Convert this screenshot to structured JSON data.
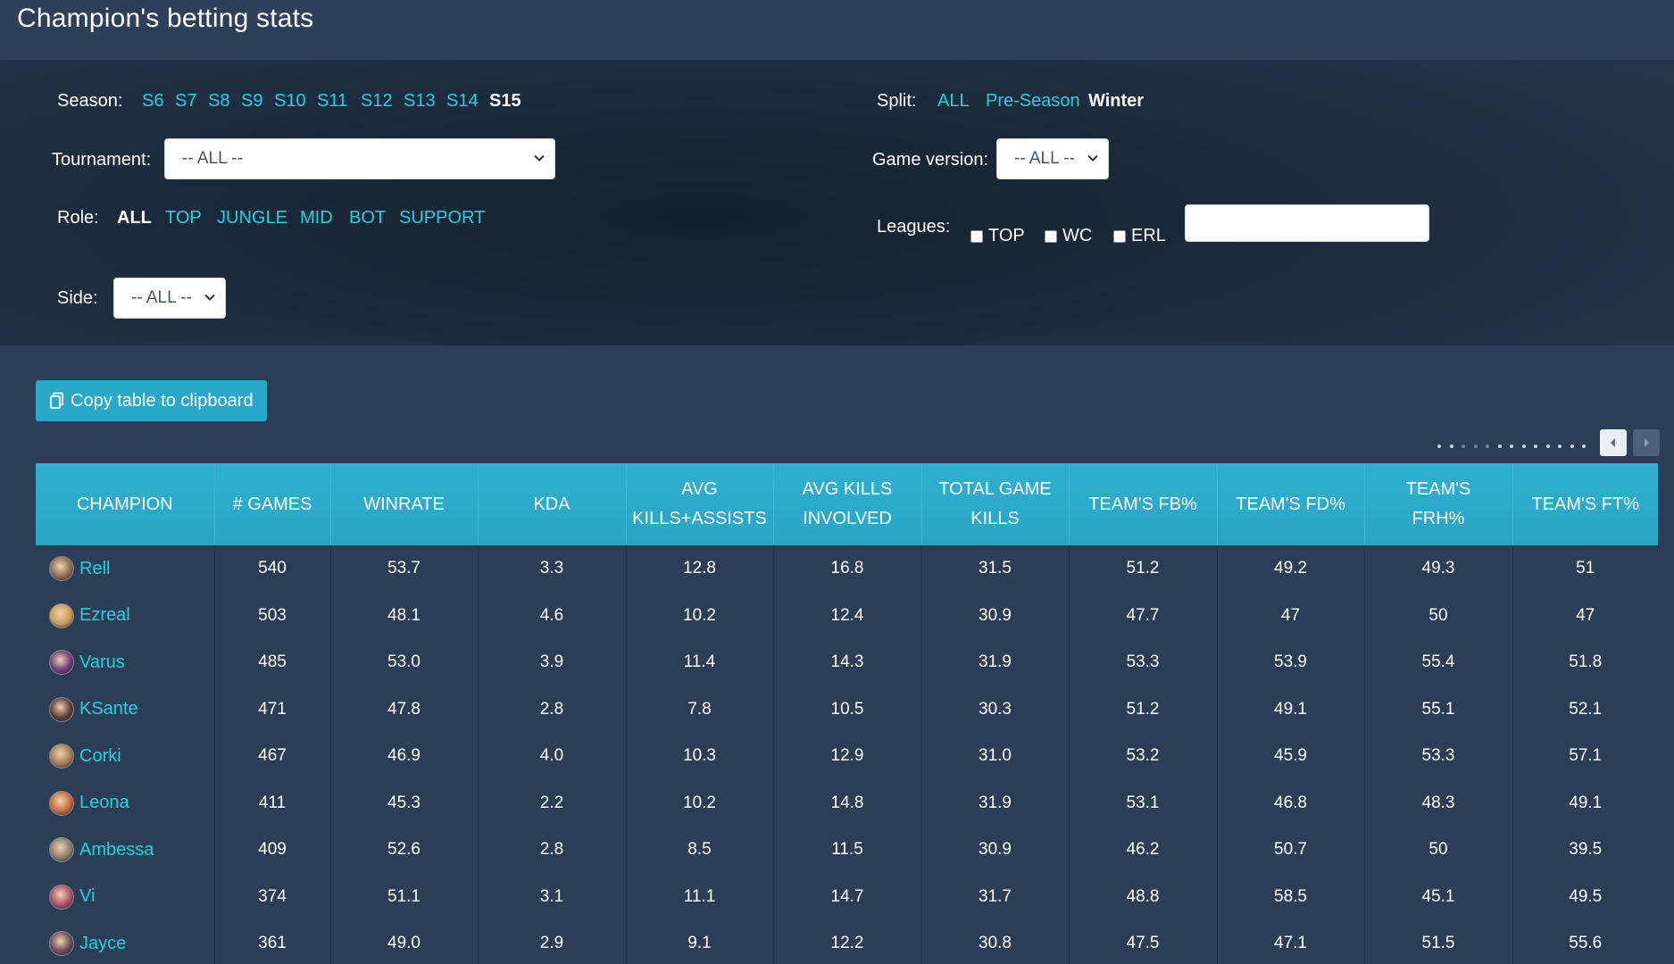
{
  "page": {
    "title": "Champion's betting stats"
  },
  "filters": {
    "season": {
      "label": "Season:",
      "options": [
        "S6",
        "S7",
        "S8",
        "S9",
        "S10",
        "S11",
        "S12",
        "S13",
        "S14",
        "S15"
      ],
      "selected": "S15"
    },
    "split": {
      "label": "Split:",
      "options": [
        "ALL",
        "Pre-Season",
        "Winter"
      ],
      "selected": "Winter"
    },
    "tournament": {
      "label": "Tournament:",
      "value": "-- ALL --"
    },
    "game_version": {
      "label": "Game version:",
      "value": "-- ALL --"
    },
    "role": {
      "label": "Role:",
      "options": [
        "ALL",
        "TOP",
        "JUNGLE",
        "MID",
        "BOT",
        "SUPPORT"
      ],
      "selected": "ALL"
    },
    "leagues": {
      "label": "Leagues:",
      "checkboxes": [
        {
          "label": "TOP",
          "checked": false
        },
        {
          "label": "WC",
          "checked": false
        },
        {
          "label": "ERL",
          "checked": false
        }
      ],
      "search_value": ""
    },
    "side": {
      "label": "Side:",
      "value": "-- ALL --"
    }
  },
  "toolbar": {
    "copy_label": "Copy table to clipboard"
  },
  "table": {
    "headers": [
      [
        "CHAMPION"
      ],
      [
        "# GAMES"
      ],
      [
        "WINRATE"
      ],
      [
        "KDA"
      ],
      [
        "AVG",
        "KILLS+ASSISTS"
      ],
      [
        "AVG KILLS",
        "INVOLVED"
      ],
      [
        "TOTAL GAME",
        "KILLS"
      ],
      [
        "TEAM'S FB%"
      ],
      [
        "TEAM'S FD%"
      ],
      [
        "TEAM'S",
        "FRH%"
      ],
      [
        "TEAM'S FT%"
      ]
    ],
    "rows": [
      {
        "champion": "Rell",
        "avatar_color": "#8a6a55",
        "cells": [
          "540",
          "53.7",
          "3.3",
          "12.8",
          "16.8",
          "31.5",
          "51.2",
          "49.2",
          "49.3",
          "51"
        ]
      },
      {
        "champion": "Ezreal",
        "avatar_color": "#c79a5a",
        "cells": [
          "503",
          "48.1",
          "4.6",
          "10.2",
          "12.4",
          "30.9",
          "47.7",
          "47",
          "50",
          "47"
        ]
      },
      {
        "champion": "Varus",
        "avatar_color": "#6b3a78",
        "cells": [
          "485",
          "53.0",
          "3.9",
          "11.4",
          "14.3",
          "31.9",
          "53.3",
          "53.9",
          "55.4",
          "51.8"
        ]
      },
      {
        "champion": "KSante",
        "avatar_color": "#5a3a35",
        "cells": [
          "471",
          "47.8",
          "2.8",
          "7.8",
          "10.5",
          "30.3",
          "51.2",
          "49.1",
          "55.1",
          "52.1"
        ]
      },
      {
        "champion": "Corki",
        "avatar_color": "#a07a55",
        "cells": [
          "467",
          "46.9",
          "4.0",
          "10.3",
          "12.9",
          "31.0",
          "53.2",
          "45.9",
          "53.3",
          "57.1"
        ]
      },
      {
        "champion": "Leona",
        "avatar_color": "#c86a3a",
        "cells": [
          "411",
          "45.3",
          "2.2",
          "10.2",
          "14.8",
          "31.9",
          "53.1",
          "46.8",
          "48.3",
          "49.1"
        ]
      },
      {
        "champion": "Ambessa",
        "avatar_color": "#8a7a70",
        "cells": [
          "409",
          "52.6",
          "2.8",
          "8.5",
          "11.5",
          "30.9",
          "46.2",
          "50.7",
          "50",
          "39.5"
        ]
      },
      {
        "champion": "Vi",
        "avatar_color": "#b04a6a",
        "cells": [
          "374",
          "51.1",
          "3.1",
          "11.1",
          "14.7",
          "31.7",
          "48.8",
          "58.5",
          "45.1",
          "49.5"
        ]
      },
      {
        "champion": "Jayce",
        "avatar_color": "#6a4a5a",
        "cells": [
          "361",
          "49.0",
          "2.9",
          "9.1",
          "12.2",
          "30.8",
          "47.5",
          "47.1",
          "51.5",
          "55.6"
        ]
      }
    ]
  },
  "colors": {
    "accent_link": "#1ed2e4",
    "table_header": "#2aa8c9",
    "background": "#2c3e55"
  }
}
